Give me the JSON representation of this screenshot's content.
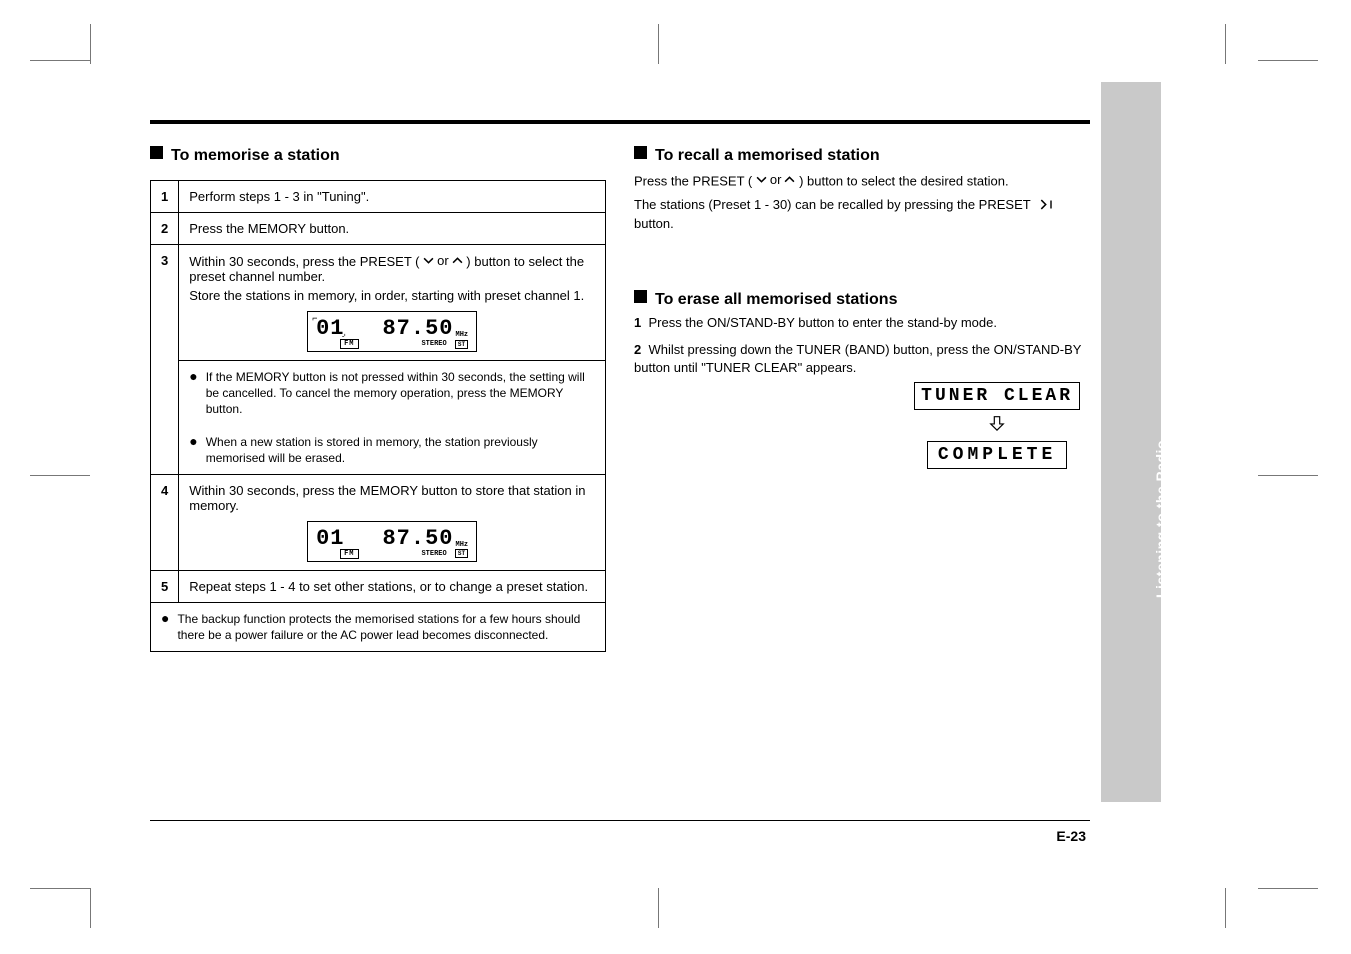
{
  "left": {
    "heading": "To memorise a station",
    "table": {
      "r1": {
        "num": "1",
        "text": "Perform steps 1 - 3 in \"Tuning\"."
      },
      "r2": {
        "num": "2",
        "text": "Press the MEMORY button."
      },
      "r3_line1": "Within 30 seconds, press the PRESET (",
      "r3_and": " or ",
      "r3_line1b": ") button to select the preset channel number.",
      "r3_line2": "Store the stations in memory, in order, starting with preset channel 1.",
      "r3_num": "3",
      "bullet_a": "If the MEMORY button is not pressed within 30 seconds, the setting will be cancelled. To cancel the memory operation, press the MEMORY button.",
      "bullet_b": "When a new station is stored in memory, the station previously memorised will be erased.",
      "r4_num": "4",
      "r4_text": "Within 30 seconds, press the MEMORY button to store that station in memory.",
      "r5_num": "5",
      "r5_text": "Repeat steps 1 - 4 to set other stations, or to change a preset station.",
      "bullet_c": "The backup function protects the memorised stations for a few hours should there be a power failure or the AC power lead becomes disconnected."
    },
    "lcd": {
      "preset": "01",
      "freq": "87.50",
      "unit": "MHz",
      "band": "FM",
      "stereo_label": "STEREO",
      "st_badge": "ST"
    }
  },
  "right": {
    "recall_heading": "To recall a memorised station",
    "recall_p1a": "Press the PRESET (",
    "recall_and": " or ",
    "recall_p1b": ") button to select the desired station.",
    "recall_p2a": "The stations (Preset 1 - 30) can be recalled by pressing the PRESET",
    "recall_p2b": " button.",
    "erase_heading": "To erase all memorised stations",
    "erase_p1": "Press the ON/STAND-BY button to enter the stand-by mode.",
    "erase_p2": "Whilst pressing down the TUNER (BAND) button, press the ON/STAND-BY button until \"TUNER CLEAR\" appears.",
    "lcd_top": "TUNER CLEAR",
    "lcd_bottom": "COMPLETE"
  },
  "side_label": "Listening to the Radio",
  "page_number": "E-23"
}
